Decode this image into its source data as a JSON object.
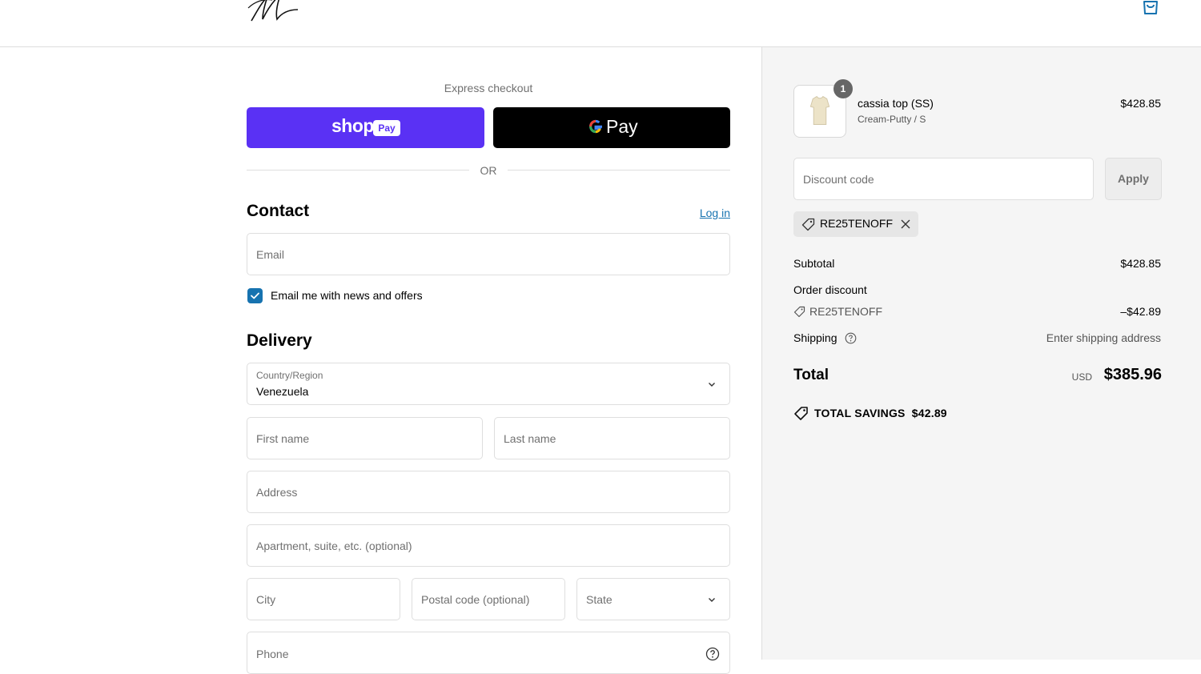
{
  "header": {
    "logo_icon": "brand-script-logo",
    "cart_icon": "shopping-bag-icon"
  },
  "express": {
    "label": "Express checkout",
    "shop_pay": {
      "shop": "shop",
      "pay": "Pay"
    },
    "gpay": {
      "g": "G",
      "pay": "Pay"
    },
    "or": "OR"
  },
  "contact": {
    "title": "Contact",
    "login": "Log in",
    "email_placeholder": "Email",
    "newsletter_label": "Email me with news and offers",
    "newsletter_checked": true
  },
  "delivery": {
    "title": "Delivery",
    "country_label": "Country/Region",
    "country_value": "Venezuela",
    "first_name": "First name",
    "last_name": "Last name",
    "address": "Address",
    "apartment": "Apartment, suite, etc. (optional)",
    "city": "City",
    "postal": "Postal code (optional)",
    "state": "State",
    "phone": "Phone"
  },
  "summary": {
    "product": {
      "name": "cassia top (SS)",
      "variant": "Cream-Putty / S",
      "price": "$428.85",
      "quantity": "1"
    },
    "discount_placeholder": "Discount code",
    "apply": "Apply",
    "applied_code": "RE25TENOFF",
    "subtotal_label": "Subtotal",
    "subtotal_value": "$428.85",
    "order_discount_label": "Order discount",
    "order_discount_code": "RE25TENOFF",
    "order_discount_value": "–$42.89",
    "shipping_label": "Shipping",
    "shipping_value": "Enter shipping address",
    "total_label": "Total",
    "currency": "USD",
    "total_value": "$385.96",
    "savings_label": "TOTAL SAVINGS",
    "savings_value": "$42.89"
  },
  "colors": {
    "accent": "#1773b0",
    "shop_pay": "#5a31f4",
    "gpay": "#000000",
    "summary_bg": "#f5f5f5"
  }
}
